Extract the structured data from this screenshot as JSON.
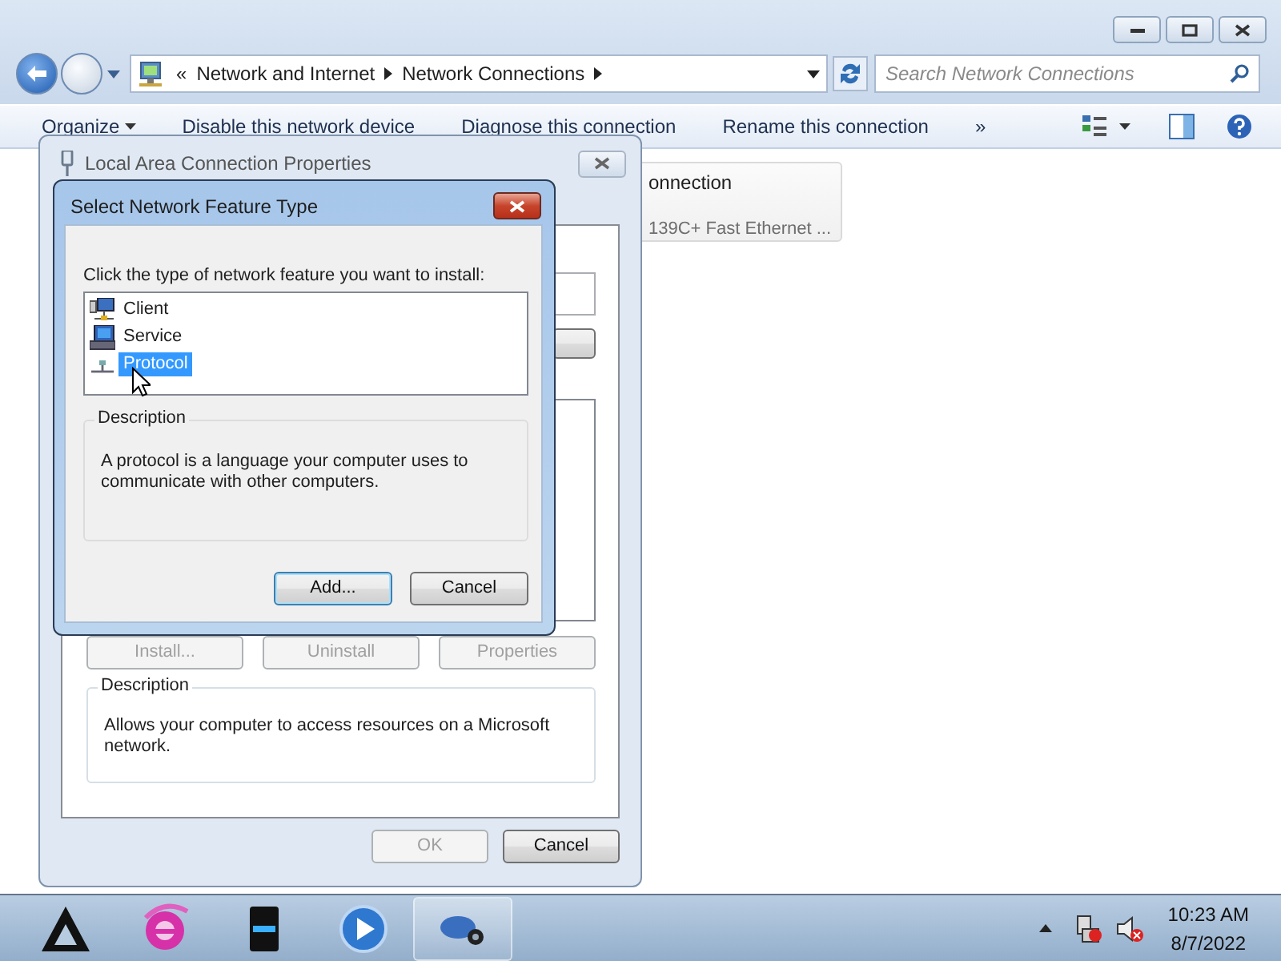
{
  "explorer": {
    "breadcrumb_overflow": "«",
    "address_path": [
      "Network and Internet",
      "Network Connections"
    ],
    "search": {
      "placeholder": "Search Network Connections"
    },
    "toolbar": [
      "Organize",
      "Disable this network device",
      "Diagnose this connection",
      "Rename this connection"
    ],
    "toolbar_overflow": "»",
    "connection": {
      "name": "onnection",
      "device": "139C+ Fast Ethernet ..."
    }
  },
  "properties_dialog": {
    "title": "Local Area Connection Properties",
    "buttons": [
      {
        "label": "Install...",
        "disabled": true
      },
      {
        "label": "Uninstall",
        "disabled": true
      },
      {
        "label": "Properties",
        "disabled": true
      }
    ],
    "description_label": "Description",
    "description": "Allows your computer to access resources on a Microsoft network.",
    "footer_buttons": [
      {
        "label": "OK",
        "disabled": true
      },
      {
        "label": "Cancel",
        "disabled": false
      }
    ]
  },
  "feature_dialog": {
    "title": "Select Network Feature Type",
    "prompt": "Click the type of network feature you want to install:",
    "features": [
      {
        "label": "Client",
        "kind": "client",
        "selected": false
      },
      {
        "label": "Service",
        "kind": "service",
        "selected": false
      },
      {
        "label": "Protocol",
        "kind": "protocol",
        "selected": true
      }
    ],
    "description_label": "Description",
    "description": "A protocol is a language your computer uses to communicate with other computers.",
    "buttons": [
      {
        "label": "Add...",
        "default": true
      },
      {
        "label": "Cancel",
        "default": false
      }
    ]
  },
  "taskbar": {
    "time": "10:23 AM",
    "date": "8/7/2022"
  }
}
